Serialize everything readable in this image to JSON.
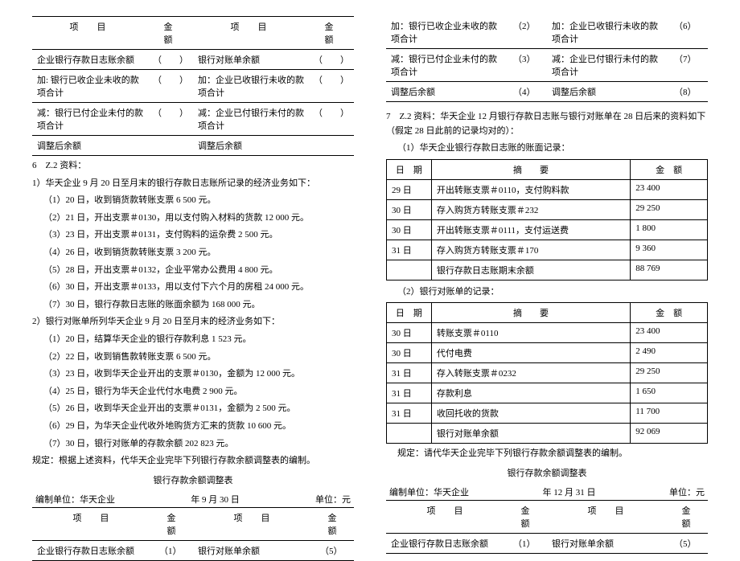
{
  "left": {
    "adj1": {
      "hdr_item1": "项　目",
      "hdr_amt1": "金　额",
      "hdr_item2": "项　目",
      "hdr_amt2": "金　额",
      "r1a": "企业银行存款日志账余额",
      "r1b": "银行对账单余额",
      "r2a": "加: 银行已收企业未收的款项合计",
      "r2b": "加：企业已收银行未收的款项合计",
      "r3a": "减：银行已付企业未付的款项合计",
      "r3b": "减：企业已付银行未付的款项合计",
      "r4a": "调整后余额",
      "r4b": "调整后余额",
      "paren": "（　　）"
    },
    "p6_head": "6　Z.2 资料：",
    "p6_1": "1）华天企业 9 月 20 日至月末的银行存款日志账所记录的经济业务如下：",
    "p6_1_1": "（1）20 日，收到销货款转账支票 6 500 元。",
    "p6_1_2": "（2）21 日，开出支票＃0130，用以支付购入材料的货款 12 000 元。",
    "p6_1_3": "（3）23 日，开出支票＃0131，支付购料的运杂费 2 500 元。",
    "p6_1_4": "（4）26 日，收到销货款转账支票 3 200 元。",
    "p6_1_5": "（5）28 日，开出支票＃0132，企业平常办公费用 4 800 元。",
    "p6_1_6": "（6）30 日，开出支票＃0133，用以支付下六个月的房租 24 000 元。",
    "p6_1_7": "（7）30 日，银行存款日志账的账面余额为 168 000 元。",
    "p6_2": "2）银行对账单所列华天企业 9 月 20 日至月末的经济业务如下：",
    "p6_2_1": "（1）20 日，结算华天企业的银行存款利息 1 523 元。",
    "p6_2_2": "（2）22 日，收到销售款转账支票 6 500 元。",
    "p6_2_3": "（3）23 日，收到华天企业开出的支票＃0130，金额为 12 000 元。",
    "p6_2_4": "（4）25 日，银行为华天企业代付水电费 2 900 元。",
    "p6_2_5": "（5）26 日，收到华天企业开出的支票＃0131，金额为 2 500 元。",
    "p6_2_6": "（6）29 日，为华天企业代收外地购货方汇来的货款 10 600 元。",
    "p6_2_7": "（7）30 日，银行对账单的存款余额 202 823 元。",
    "p6_req": "规定：根据上述资料，代华天企业完毕下列银行存款余额调整表的编制。",
    "adj2_title": "银行存款余额调整表",
    "adj2_meta_l": "编制单位：华天企业",
    "adj2_meta_c": "年 9 月 30 日",
    "adj2_meta_r": "单位：元",
    "adj2_r1a": "企业银行存款日志账余额",
    "adj2_r1a_v": "（1）",
    "adj2_r1b": "银行对账单余额",
    "adj2_r1b_v": "（5）"
  },
  "right": {
    "adjTop": {
      "r2a": "加：银行已收企业未收的款项合计",
      "r2a_v": "（2）",
      "r2b": "加：企业已收银行未收的款项合计",
      "r2b_v": "（6）",
      "r3a": "减：银行已付企业未付的款项合计",
      "r3a_v": "（3）",
      "r3b": "减：企业已付银行未付的款项合计",
      "r3b_v": "（7）",
      "r4a": "调整后余额",
      "r4a_v": "（4）",
      "r4b": "调整后余额",
      "r4b_v": "（8）"
    },
    "p7_head": "7　Z.2 资料：华天企业 12 月银行存款日志账与银行对账单在 28 日后来的资料如下（假定 28 日此前的记录均对的）：",
    "p7_sub1": "（1）华天企业银行存款日志账的账面记录：",
    "t1": {
      "h1": "日　期",
      "h2": "摘　　要",
      "h3": "金　额",
      "rows": [
        {
          "d": "29 日",
          "m": "开出转账支票＃0110，支付购料款",
          "a": "23 400"
        },
        {
          "d": "30 日",
          "m": "存入购货方转账支票＃232",
          "a": "29 250"
        },
        {
          "d": "30 日",
          "m": "开出转账支票＃0111，支付运送费",
          "a": "1 800"
        },
        {
          "d": "31 日",
          "m": "存入购货方转账支票＃170",
          "a": "9 360"
        },
        {
          "d": "",
          "m": "银行存款日志账期末余额",
          "a": "88 769"
        }
      ]
    },
    "p7_sub2": "（2）银行对账单的记录：",
    "t2": {
      "h1": "日　期",
      "h2": "摘　　要",
      "h3": "金　额",
      "rows": [
        {
          "d": "30 日",
          "m": "转账支票＃0110",
          "a": "23 400"
        },
        {
          "d": "30 日",
          "m": "代付电费",
          "a": "2 490"
        },
        {
          "d": "31 日",
          "m": "存入转账支票＃0232",
          "a": "29 250"
        },
        {
          "d": "31 日",
          "m": "存款利息",
          "a": "1 650"
        },
        {
          "d": "31 日",
          "m": "收回托收的货款",
          "a": "11 700"
        },
        {
          "d": "",
          "m": "银行对账单余额",
          "a": "92 069"
        }
      ]
    },
    "p7_req": "规定：请代华天企业完毕下列银行存款余额调整表的编制。",
    "adj3_title": "银行存款余额调整表",
    "adj3_meta_l": "编制单位：华天企业",
    "adj3_meta_c": "年 12 月 31 日",
    "adj3_meta_r": "单位：元",
    "adj3_h1": "项　目",
    "adj3_h2": "金　额",
    "adj3_h3": "项　目",
    "adj3_h4": "金　额",
    "adj3_r1a": "企业银行存款日志账余额",
    "adj3_r1a_v": "（1）",
    "adj3_r1b": "银行对账单余额",
    "adj3_r1b_v": "（5）"
  }
}
